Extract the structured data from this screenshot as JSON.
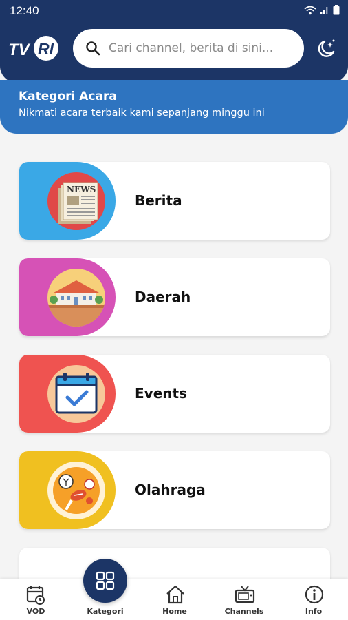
{
  "status_bar": {
    "time": "12:40"
  },
  "header": {
    "logo_text": "TVRI",
    "search": {
      "placeholder": "Cari channel, berita di sini...",
      "value": ""
    },
    "theme_icon": "moon-stars-icon"
  },
  "banner": {
    "title": "Kategori Acara",
    "subtitle": "Nikmati acara terbaik kami sepanjang minggu ini"
  },
  "categories": [
    {
      "label": "Berita",
      "color": "#3aa8e6",
      "icon": "newspaper-icon",
      "illus_text": "NEWS"
    },
    {
      "label": "Daerah",
      "color": "#d652b6",
      "icon": "town-icon"
    },
    {
      "label": "Events",
      "color": "#ef5350",
      "icon": "calendar-check-icon"
    },
    {
      "label": "Olahraga",
      "color": "#f0c020",
      "icon": "sports-icon"
    }
  ],
  "bottom_nav": {
    "items": [
      {
        "label": "VOD",
        "icon": "clock-calendar-icon"
      },
      {
        "label": "Kategori",
        "icon": "grid-icon",
        "active": true
      },
      {
        "label": "Home",
        "icon": "home-icon"
      },
      {
        "label": "Channels",
        "icon": "tv-icon"
      },
      {
        "label": "Info",
        "icon": "info-icon"
      }
    ]
  },
  "colors": {
    "primary": "#1c3566",
    "banner": "#2e74c0"
  }
}
